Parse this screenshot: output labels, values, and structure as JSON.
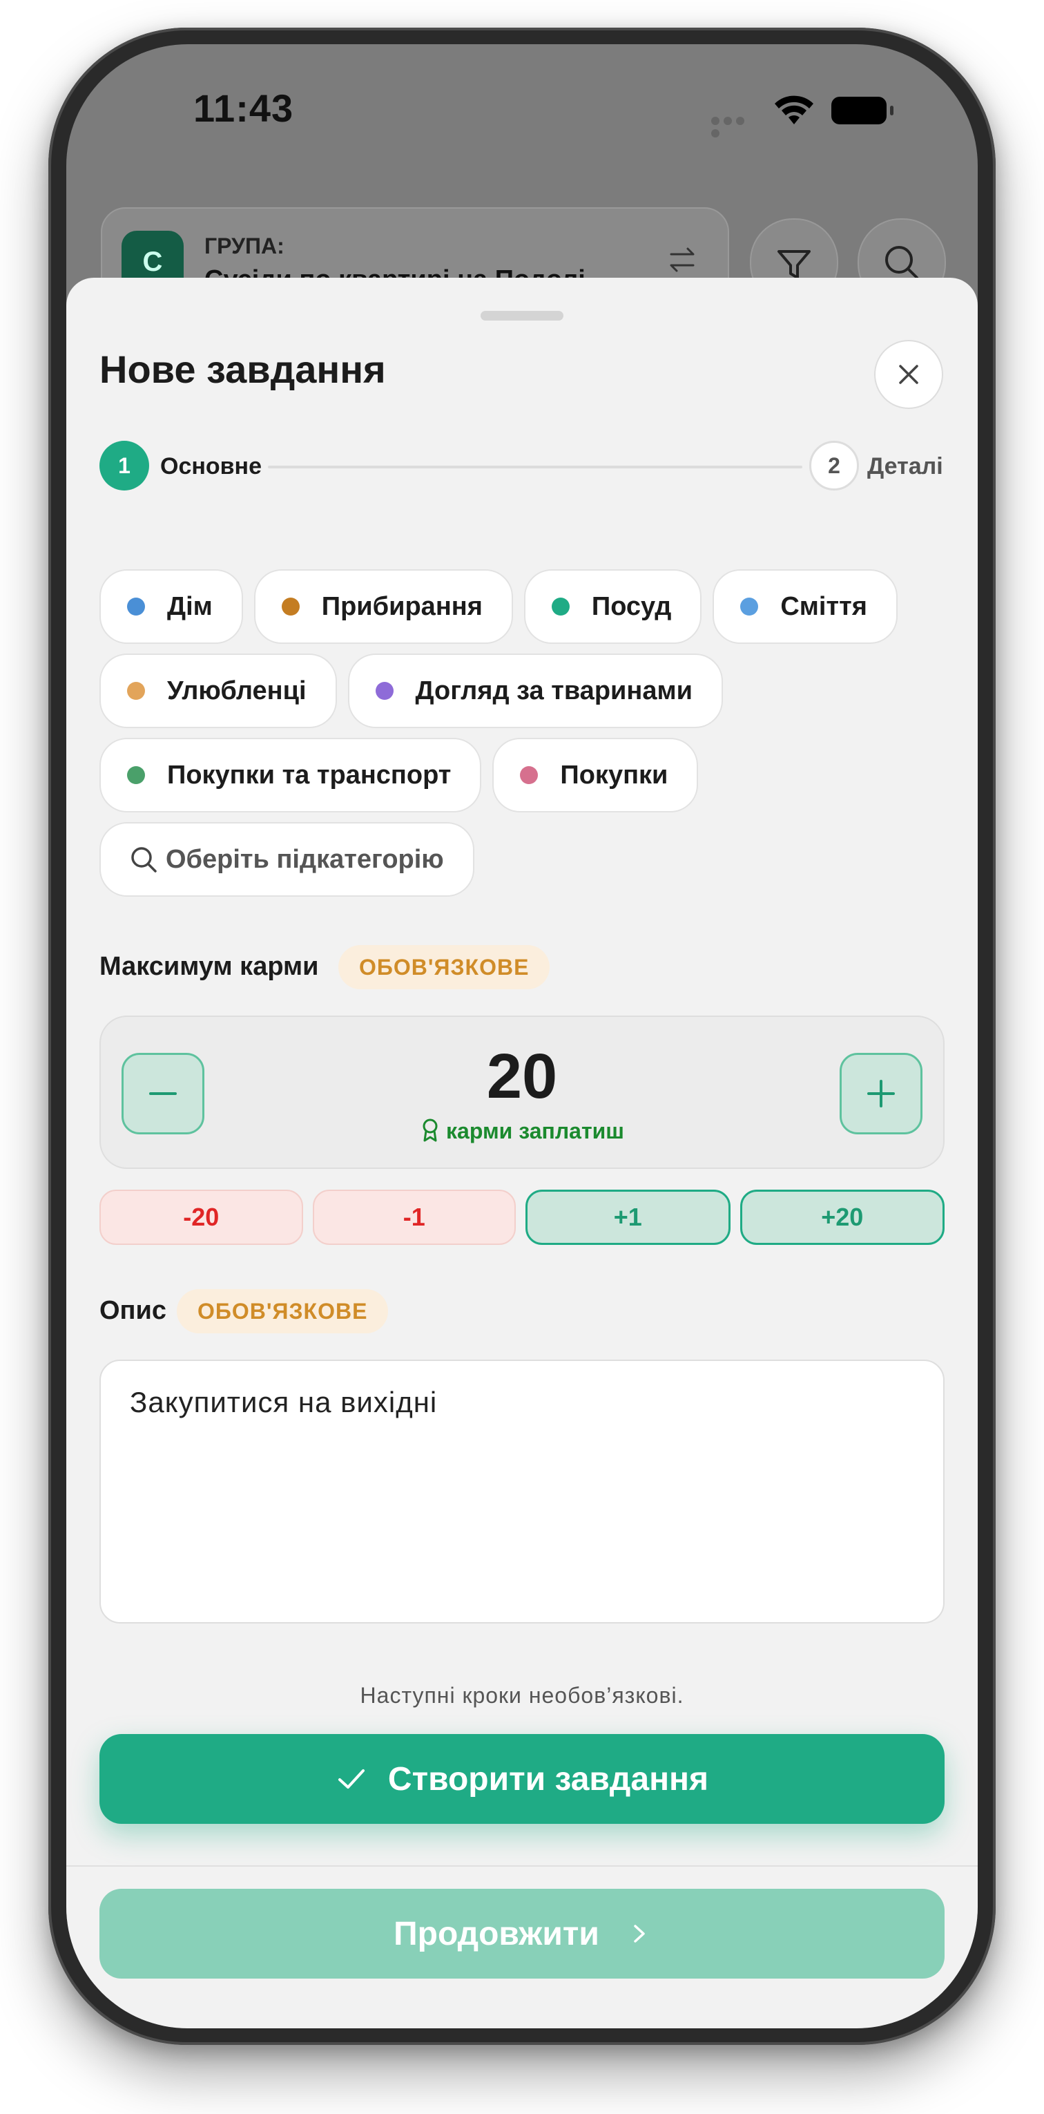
{
  "status_bar": {
    "time": "11:43"
  },
  "header": {
    "group_initial": "С",
    "group_label": "ГРУПА:",
    "group_name": "Сусіди по квартирі на Подолі"
  },
  "sheet": {
    "title": "Нове завдання",
    "steps": [
      {
        "number": "1",
        "label": "Основне",
        "active": true
      },
      {
        "number": "2",
        "label": "Деталі",
        "active": false
      }
    ],
    "categories": [
      {
        "label": "Дім",
        "color": "#4a8fd6"
      },
      {
        "label": "Прибирання",
        "color": "#c47d22"
      },
      {
        "label": "Посуд",
        "color": "#1fab85"
      },
      {
        "label": "Сміття",
        "color": "#5b9fe0"
      },
      {
        "label": "Улюбленці",
        "color": "#e2a45a"
      },
      {
        "label": "Догляд за тваринами",
        "color": "#8e6bd8"
      },
      {
        "label": "Покупки та транспорт",
        "color": "#4aa06a"
      },
      {
        "label": "Покупки",
        "color": "#d6708e"
      }
    ],
    "subcategory_placeholder": "Оберіть підкатегорію",
    "karma": {
      "label": "Максимум карми",
      "required_badge": "ОБОВ'ЯЗКОВЕ",
      "value": "20",
      "caption": "карми заплатиш",
      "quick_adjust": [
        "-20",
        "-1",
        "+1",
        "+20"
      ]
    },
    "description": {
      "label": "Опис",
      "required_badge": "ОБОВ'ЯЗКОВЕ",
      "value": "Закупитися на вихідні"
    },
    "hint": "Наступні кроки необов’язкові.",
    "create_button": "Створити завдання",
    "continue_button": "Продовжити"
  },
  "colors": {
    "accent": "#1fab85",
    "accent_light": "#88d0b8",
    "required_text": "#d08c28",
    "negative": "#e02626"
  }
}
